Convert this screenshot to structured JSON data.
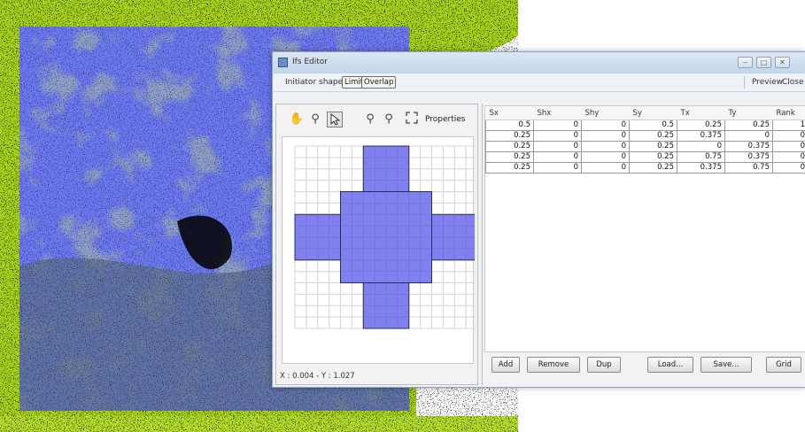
{
  "window": {
    "title": "Ifs Editor",
    "controls": {
      "minimize": "‒",
      "maximize": "□",
      "close": "✕"
    }
  },
  "toolbar": {
    "initiator_label": "Initiator shape",
    "limit_label": "Limit",
    "overlap_label": "Overlap",
    "preview_label": "Preview",
    "close_label": "Close"
  },
  "drawing_tools": {
    "properties_label": "Properties",
    "icons": [
      "hand-pan-icon",
      "zoom-icon",
      "select-arrow-icon",
      "zoom-in-icon",
      "zoom-out-icon",
      "fit-view-icon"
    ]
  },
  "status": {
    "coords": "X : 0.004 - Y : 1.027"
  },
  "table": {
    "columns": [
      "Sx",
      "Shx",
      "Shy",
      "Sy",
      "Tx",
      "Ty",
      "Rank"
    ],
    "rows": [
      [
        "0.5",
        "0",
        "0",
        "0.5",
        "0.25",
        "0.25",
        "1"
      ],
      [
        "0.25",
        "0",
        "0",
        "0.25",
        "0.375",
        "0",
        "0"
      ],
      [
        "0.25",
        "0",
        "0",
        "0.25",
        "0",
        "0.375",
        "0"
      ],
      [
        "0.25",
        "0",
        "0",
        "0.25",
        "0.75",
        "0.375",
        "0"
      ],
      [
        "0.25",
        "0",
        "0",
        "0.25",
        "0.375",
        "0.75",
        "0"
      ]
    ]
  },
  "buttons": {
    "add": "Add",
    "remove": "Remove",
    "dup": "Dup",
    "load": "Load...",
    "save": "Save...",
    "grid": "Grid"
  },
  "colors": {
    "shape_fill": "#8080ee",
    "shape_stroke": "#2a2a55",
    "map_overlay": "#6b78f0",
    "map_green": "#a6d21c"
  }
}
